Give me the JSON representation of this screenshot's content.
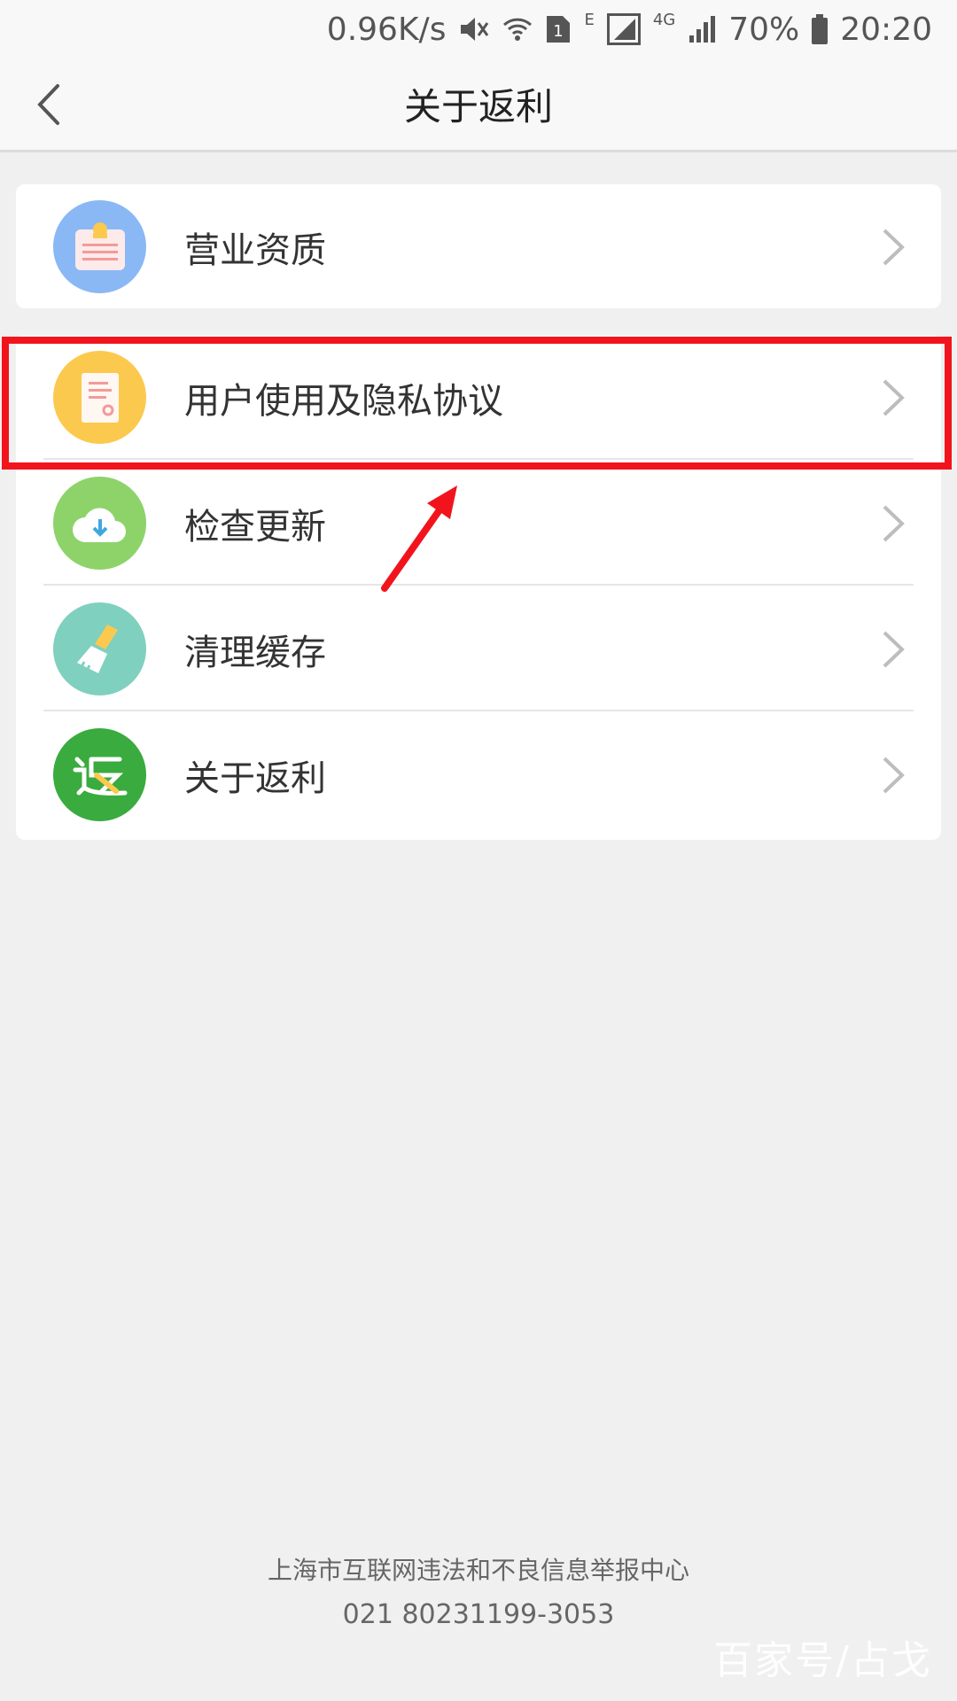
{
  "status_bar": {
    "net_speed": "0.96K/s",
    "sim_label": "1",
    "edge_label": "E",
    "net_type": "4G",
    "battery": "70%",
    "time": "20:20"
  },
  "nav": {
    "title": "关于返利"
  },
  "menu": {
    "group1": [
      {
        "label": "营业资质",
        "icon": "license-icon",
        "color": "#8ab8f5"
      }
    ],
    "group2": [
      {
        "label": "用户使用及隐私协议",
        "icon": "document-icon",
        "color": "#fcc94f"
      },
      {
        "label": "检查更新",
        "icon": "cloud-download-icon",
        "color": "#8dd36a"
      },
      {
        "label": "清理缓存",
        "icon": "broom-icon",
        "color": "#7fd0bf"
      },
      {
        "label": "关于返利",
        "icon": "fanli-logo-icon",
        "color": "#3aab3e"
      }
    ]
  },
  "footer": {
    "line1": "上海市互联网违法和不良信息举报中心",
    "line2": "021 80231199-3053"
  },
  "watermark": "百家号/占戈",
  "colors": {
    "highlight": "#f2141d",
    "background": "#f0f0f0"
  }
}
